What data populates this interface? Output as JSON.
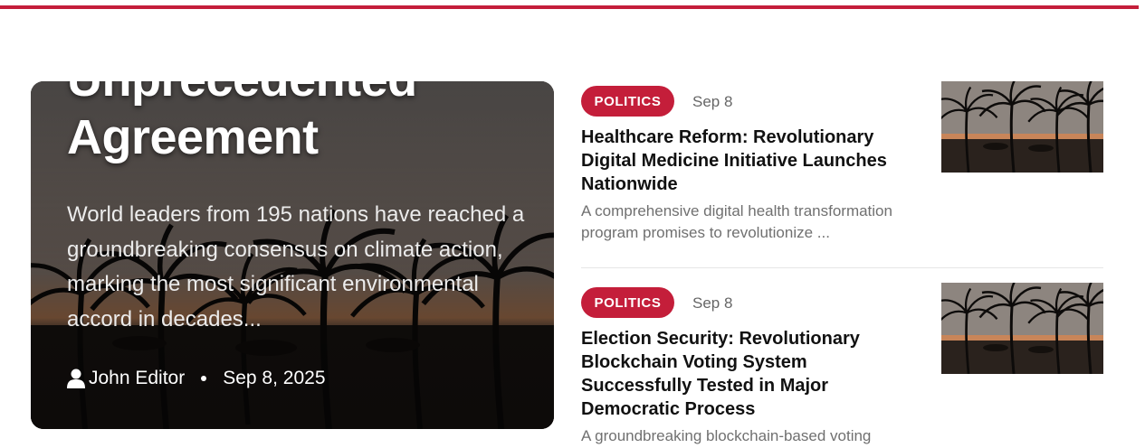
{
  "colors": {
    "accent": "#c41e3a"
  },
  "featured": {
    "title": "Unprecedented Agreement",
    "summary": "World leaders from 195 nations have reached a groundbreaking consensus on climate action, marking the most significant environmental accord in decades...",
    "author": "John Editor",
    "date": "Sep 8, 2025",
    "author_icon": "user-icon"
  },
  "articles": [
    {
      "category": "POLITICS",
      "date": "Sep 8",
      "headline": "Healthcare Reform: Revolutionary Digital Medicine Initiative Launches Nationwide",
      "excerpt": "A comprehensive digital health transformation program promises to revolutionize ..."
    },
    {
      "category": "POLITICS",
      "date": "Sep 8",
      "headline": "Election Security: Revolutionary Blockchain Voting System Successfully Tested in Major Democratic Process",
      "excerpt": "A groundbreaking blockchain-based voting"
    }
  ]
}
